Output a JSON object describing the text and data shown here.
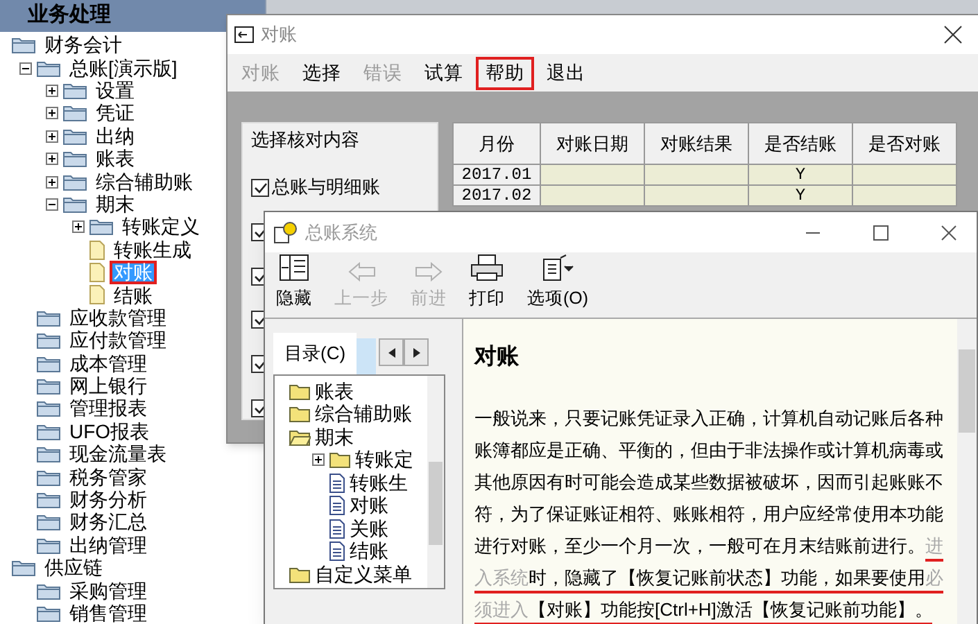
{
  "sidebar": {
    "title": "业务处理",
    "tree": [
      {
        "label": "财务会计",
        "kind": "folder",
        "children": [
          {
            "label": "总账[演示版]",
            "kind": "folder",
            "expanded": true,
            "children": [
              {
                "label": "设置",
                "kind": "folder",
                "expanded": false
              },
              {
                "label": "凭证",
                "kind": "folder",
                "expanded": false
              },
              {
                "label": "出纳",
                "kind": "folder",
                "expanded": false
              },
              {
                "label": "账表",
                "kind": "folder",
                "expanded": false
              },
              {
                "label": "综合辅助账",
                "kind": "folder",
                "expanded": false
              },
              {
                "label": "期末",
                "kind": "folder",
                "expanded": true,
                "children": [
                  {
                    "label": "转账定义",
                    "kind": "folder",
                    "expanded": false
                  },
                  {
                    "label": "转账生成",
                    "kind": "doc"
                  },
                  {
                    "label": "对账",
                    "kind": "doc",
                    "selected": true,
                    "highlighted": true
                  },
                  {
                    "label": "结账",
                    "kind": "doc"
                  }
                ]
              }
            ]
          },
          {
            "label": "应收款管理",
            "kind": "folder"
          },
          {
            "label": "应付款管理",
            "kind": "folder"
          },
          {
            "label": "成本管理",
            "kind": "folder"
          },
          {
            "label": "网上银行",
            "kind": "folder"
          },
          {
            "label": "管理报表",
            "kind": "folder"
          },
          {
            "label": "UFO报表",
            "kind": "folder"
          },
          {
            "label": "现金流量表",
            "kind": "folder"
          },
          {
            "label": "税务管家",
            "kind": "folder"
          },
          {
            "label": "财务分析",
            "kind": "folder"
          },
          {
            "label": "财务汇总",
            "kind": "folder"
          },
          {
            "label": "出纳管理",
            "kind": "folder"
          }
        ]
      },
      {
        "label": "供应链",
        "kind": "folder",
        "children": [
          {
            "label": "采购管理",
            "kind": "folder"
          },
          {
            "label": "销售管理",
            "kind": "folder"
          }
        ]
      }
    ]
  },
  "dialog": {
    "title": "对账",
    "menu": [
      {
        "label": "对账",
        "disabled": true,
        "highlighted": false
      },
      {
        "label": "选择",
        "disabled": false,
        "highlighted": false
      },
      {
        "label": "错误",
        "disabled": true,
        "highlighted": false
      },
      {
        "label": "试算",
        "disabled": false,
        "highlighted": false
      },
      {
        "label": "帮助",
        "disabled": false,
        "highlighted": true
      },
      {
        "label": "退出",
        "disabled": false,
        "highlighted": false
      }
    ],
    "group_title": "选择核对内容",
    "checkboxes": [
      {
        "label": "总账与明细账",
        "checked": true
      },
      {
        "checked": true
      },
      {
        "checked": true
      },
      {
        "checked": true
      },
      {
        "checked": true
      },
      {
        "checked": true
      }
    ],
    "table": {
      "columns": [
        "月份",
        "对账日期",
        "对账结果",
        "是否结账",
        "是否对账"
      ],
      "rows": [
        [
          "2017.01",
          "",
          "",
          "Y",
          ""
        ],
        [
          "2017.02",
          "",
          "",
          "Y",
          ""
        ]
      ]
    }
  },
  "help_window": {
    "title": "总账系统",
    "toolbar": [
      {
        "label": "隐藏",
        "kind": "hide",
        "disabled": false
      },
      {
        "label": "上一步",
        "kind": "back",
        "disabled": true
      },
      {
        "label": "前进",
        "kind": "forward",
        "disabled": true
      },
      {
        "label": "打印",
        "kind": "print",
        "disabled": false
      },
      {
        "label": "选项(O)",
        "kind": "options",
        "disabled": false
      }
    ],
    "tabs": [
      {
        "label": "目录(C)",
        "selected": true
      },
      {
        "selected": false
      }
    ],
    "tree": [
      {
        "label": "账表",
        "kind": "folder"
      },
      {
        "label": "综合辅助账",
        "kind": "folder"
      },
      {
        "label": "期末",
        "kind": "folder",
        "expanded": true,
        "children": [
          {
            "label": "转账定",
            "kind": "folder",
            "expanded": false
          },
          {
            "label": "转账生",
            "kind": "doc"
          },
          {
            "label": "对账",
            "kind": "doc"
          },
          {
            "label": "关账",
            "kind": "doc"
          },
          {
            "label": "结账",
            "kind": "doc"
          }
        ]
      },
      {
        "label": "自定义菜单",
        "kind": "folder"
      }
    ],
    "heading": "对账",
    "paragraph": [
      {
        "text": "一般说来，只要记账凭证录入正确，计算机自动记账后各种账簿都应是正确、平衡的，但由于非法操作或计算机病毒或其他原因有时可能会造成某些数据被破坏，因而引起账账不符，为了保证账证相符、账账相符，用户应经常使用本功能进行对账，至少一个月一次，一般可在月末结账前进行。",
        "faded": false,
        "underlined": false
      },
      {
        "text": "进入系统",
        "faded": true,
        "underlined": true
      },
      {
        "text": "时，隐藏了【恢复记账前状态】功能，如果要使用",
        "faded": false,
        "underlined": true
      },
      {
        "text": "必须进入",
        "faded": true,
        "underlined": true
      },
      {
        "text": "【对账】功能按[Ctrl+H]激活【恢复记账前功能】。",
        "faded": false,
        "underlined": true
      }
    ]
  }
}
